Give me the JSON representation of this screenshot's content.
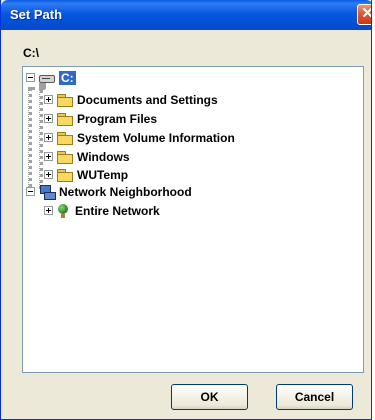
{
  "window": {
    "title": "Set Path",
    "close_glyph": "✕"
  },
  "current_path": "C:\\",
  "tree": {
    "drive": {
      "label": "C:",
      "icon": "drive-icon"
    },
    "folders": [
      {
        "label": "Documents and Settings",
        "icon": "folder-icon"
      },
      {
        "label": "Program Files",
        "icon": "folder-icon"
      },
      {
        "label": "System Volume Information",
        "icon": "folder-icon"
      },
      {
        "label": "Windows",
        "icon": "folder-icon"
      },
      {
        "label": "WUTemp",
        "icon": "folder-icon"
      }
    ],
    "network": {
      "label": "Network Neighborhood",
      "icon": "network-icon"
    },
    "network_children": [
      {
        "label": "Entire Network",
        "icon": "globe-icon"
      }
    ]
  },
  "buttons": {
    "ok": "OK",
    "cancel": "Cancel"
  },
  "colors": {
    "title_bar": "#0858e0",
    "selection": "#316ac5",
    "dialog_bg": "#ece9d8"
  }
}
